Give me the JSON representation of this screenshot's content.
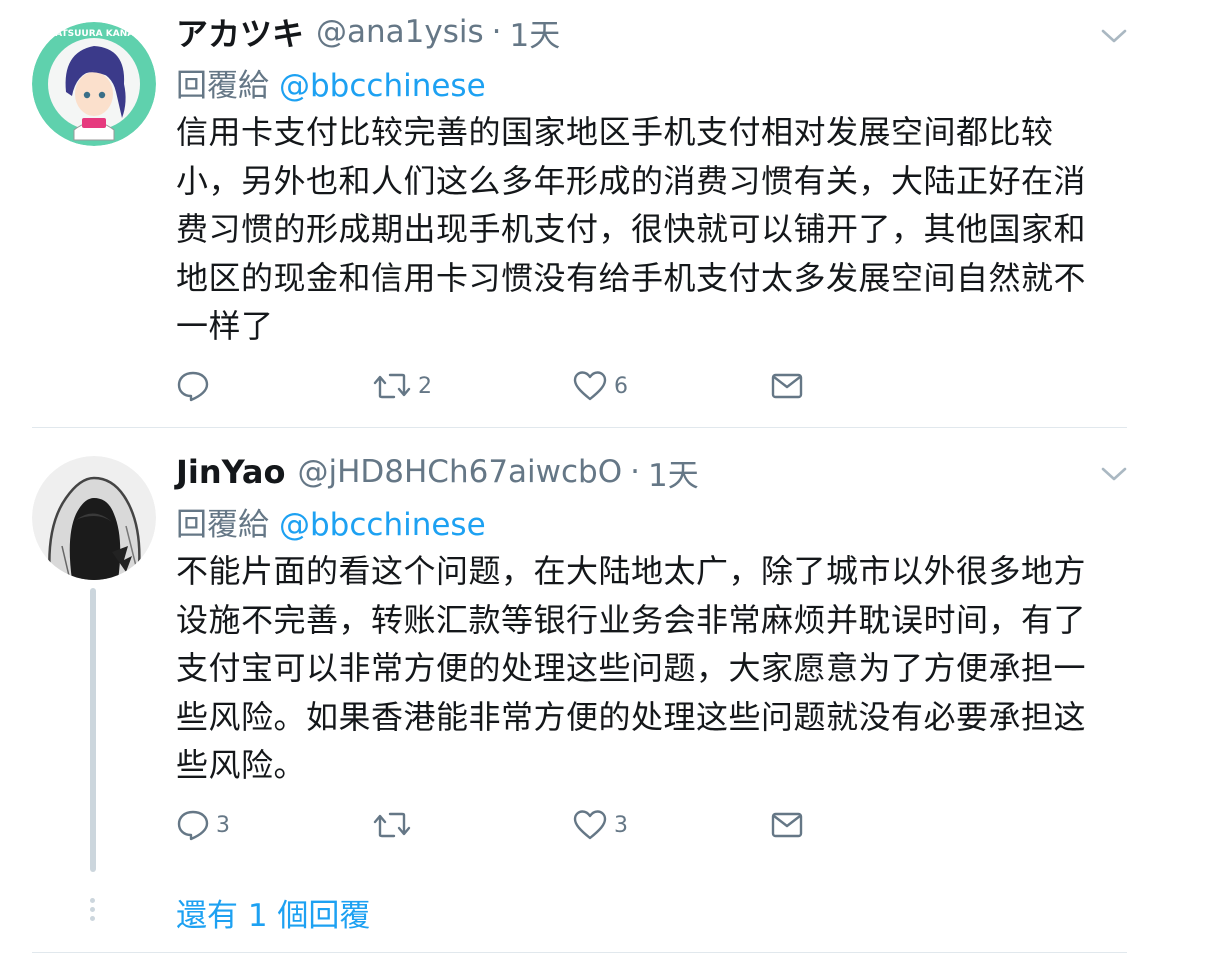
{
  "tweets": [
    {
      "name": "アカツキ",
      "handle": "@ana1ysis",
      "dot": "·",
      "time": "1天",
      "reply_prefix": "回覆給",
      "reply_to": "@bbcchinese",
      "lines": [
        "信用卡支付比较完善的国家地区手机支付相对发展空间都比较",
        "小，另外也和人们这么多年形成的消费习惯有关，大陆正好在消",
        "费习惯的形成期出现手机支付，很快就可以铺开了，其他国家和",
        "地区的现金和信用卡习惯没有给手机支付太多发展空间自然就不",
        "一样了"
      ],
      "reply_count": "",
      "retweet_count": "2",
      "like_count": "6",
      "avatar_text": "MATSUURA KANAN"
    },
    {
      "name": "JinYao",
      "handle": "@jHD8HCh67aiwcbO",
      "dot": "·",
      "time": "1天",
      "reply_prefix": "回覆給",
      "reply_to": "@bbcchinese",
      "lines": [
        "不能片面的看这个问题，在大陆地太广，除了城市以外很多地方",
        "设施不完善，转账汇款等银行业务会非常麻烦并耽误时间，有了",
        "支付宝可以非常方便的处理这些问题，大家愿意为了方便承担一",
        "些风险。如果香港能非常方便的处理这些问题就没有必要承担这",
        "些风险。"
      ],
      "reply_count": "3",
      "retweet_count": "",
      "like_count": "3"
    }
  ],
  "show_more_replies": "還有 1 個回覆",
  "colors": {
    "text": "#14171a",
    "secondary": "#657786",
    "link": "#1da1f2",
    "divider": "#e1e8ed",
    "thread_line": "#ccd6dd"
  },
  "icons": [
    "reply-icon",
    "retweet-icon",
    "like-icon",
    "message-icon",
    "chevron-down-icon"
  ]
}
